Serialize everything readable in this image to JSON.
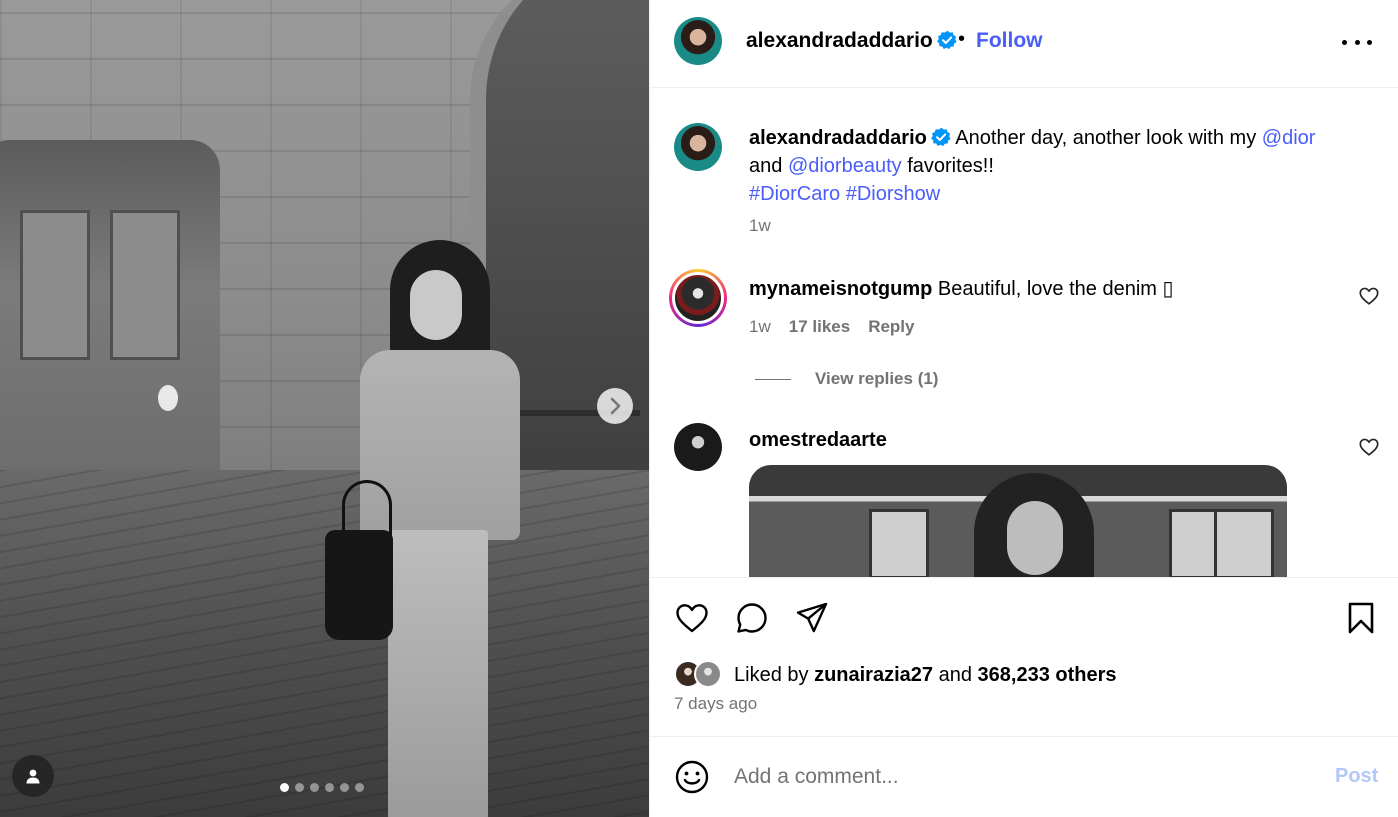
{
  "post": {
    "author": "alexandradaddario",
    "follow_label": "Follow",
    "separator": "•",
    "carousel": {
      "total_slides": 6,
      "active_index": 0
    }
  },
  "caption": {
    "username": "alexandradaddario",
    "text_1": " Another day, another look with my ",
    "mention_1": "@dior",
    "text_2": " and ",
    "mention_2": "@diorbeauty",
    "text_3": " favorites!!",
    "hashtag_1": "#DiorCaro",
    "hashtag_2": "#Diorshow",
    "time": "1w"
  },
  "comments": [
    {
      "username": "mynameisnotgump",
      "text": " Beautiful, love the denim ▯",
      "time": "1w",
      "likes": "17 likes",
      "reply_label": "Reply",
      "view_replies": "View replies (1)"
    },
    {
      "username": "omestredaarte",
      "attachment": "gif"
    }
  ],
  "likes": {
    "prefix": "Liked by ",
    "user": "zunairazia27",
    "middle": " and ",
    "others": "368,233 others"
  },
  "posted_ago": "7 days ago",
  "add_comment": {
    "placeholder": "Add a comment...",
    "post_label": "Post"
  },
  "icons": {
    "verified": "verified-badge-icon",
    "more": "more-options-icon",
    "like": "heart-icon",
    "comment": "comment-icon",
    "share": "share-icon",
    "save": "bookmark-icon",
    "emoji": "emoji-icon",
    "next": "chevron-right-icon",
    "tags": "user-tag-icon"
  },
  "colors": {
    "link": "#4a5df9",
    "muted": "#737373",
    "verified": "#0095f6",
    "post_disabled": "#b3c7fa"
  }
}
